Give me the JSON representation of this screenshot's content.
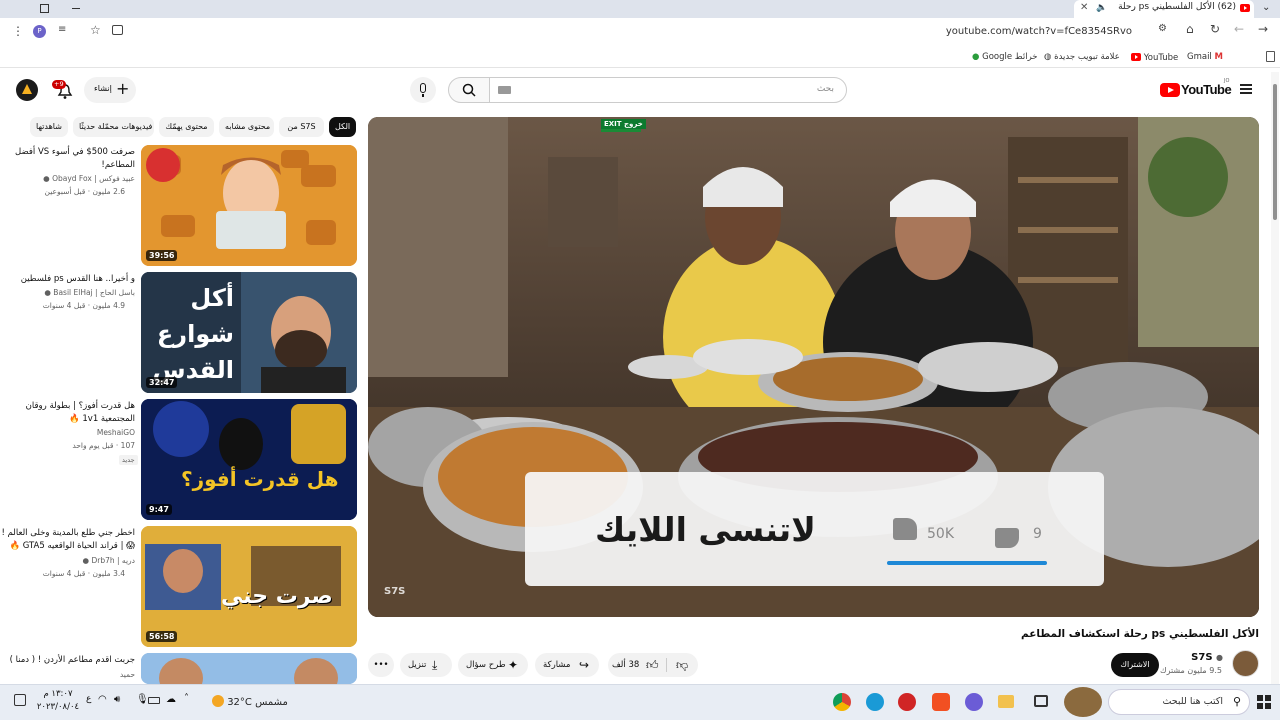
{
  "browser": {
    "tab_title": "(62) الأكل الفلسطيني ps رحلة",
    "url": "youtube.com/watch?v=fCe8354SRvo",
    "new_tab": "+",
    "bookmarks": [
      {
        "label": "Gmail"
      },
      {
        "label": "YouTube"
      },
      {
        "label": "علامة تبويب جديدة"
      },
      {
        "label": "خرائط Google"
      }
    ]
  },
  "youtube": {
    "logo_text": "YouTube",
    "country_code": "JO",
    "search_placeholder": "بحث",
    "create_label": "إنشاء",
    "notif_count": "+9",
    "filters": [
      "الكل",
      "من S7S",
      "محتوى مشابه",
      "محتوى يهمّك",
      "فيديوهات محمّلة حديثًا",
      "شاهدتها"
    ]
  },
  "video": {
    "title": "الأكل الفلسطيني ps رحلة استكشاف المطاعم",
    "channel": "S7S",
    "subscribers": "9.5 مليون مشترك",
    "subscribe": "الاشتراك",
    "likes": "38 ألف",
    "share": "مشاركة",
    "ask": "طرح سؤال",
    "download": "تنزيل",
    "overlay_text": "لاتنسى اللايك",
    "overlay_likes": "50K",
    "overlay_dislikes": "9",
    "watermark": "S7S",
    "exit_sign": "EXIT خروج"
  },
  "sidebar": [
    {
      "title": "صرفت 500$ في أسوء VS أفضل المطاعم!",
      "channel": "عبيد فوكس | Obayd Fox",
      "meta": "2.6 مليون · قبل أسبوعين",
      "duration": "39:56"
    },
    {
      "title": "و أخيرا.. هنا القدس ps فلسطين",
      "channel": "باسل الحاج | Basil ElHaj",
      "meta": "4.9 مليون · قبل 4 سنوات",
      "duration": "32:47",
      "thumb_text": "أكل شوارع القدس"
    },
    {
      "title": "هل قدرت أفوز؟ | بطولة روقان المجتمعية 1v1 🔥",
      "channel": "MeshaiGO",
      "meta": "107 · قبل يوم واحد",
      "badge": "جديد",
      "duration": "9:47",
      "thumb_text": "هل قدرت أفوز؟"
    },
    {
      "title": "اخطر جني طلع بالمدينة وخلى العالم ! 😱 | قراند الحياة الواقعيه GTA5 🔥",
      "channel": "دريه | Drb7h",
      "meta": "3.4 مليون · قبل 4 سنوات",
      "duration": "56:58",
      "thumb_text": "صرت جني"
    },
    {
      "title": "جربت اقدم مطاعم الأردن ! ( دمنا )",
      "channel": "حميد",
      "meta": "",
      "duration": ""
    }
  ],
  "taskbar": {
    "search": "اكتب هنا للبحث",
    "weather": "32°C  مشمس",
    "time": "١٣:٠٧ م",
    "date": "٢٠٢٣/٠٨/٠٤",
    "lang": "ع"
  }
}
